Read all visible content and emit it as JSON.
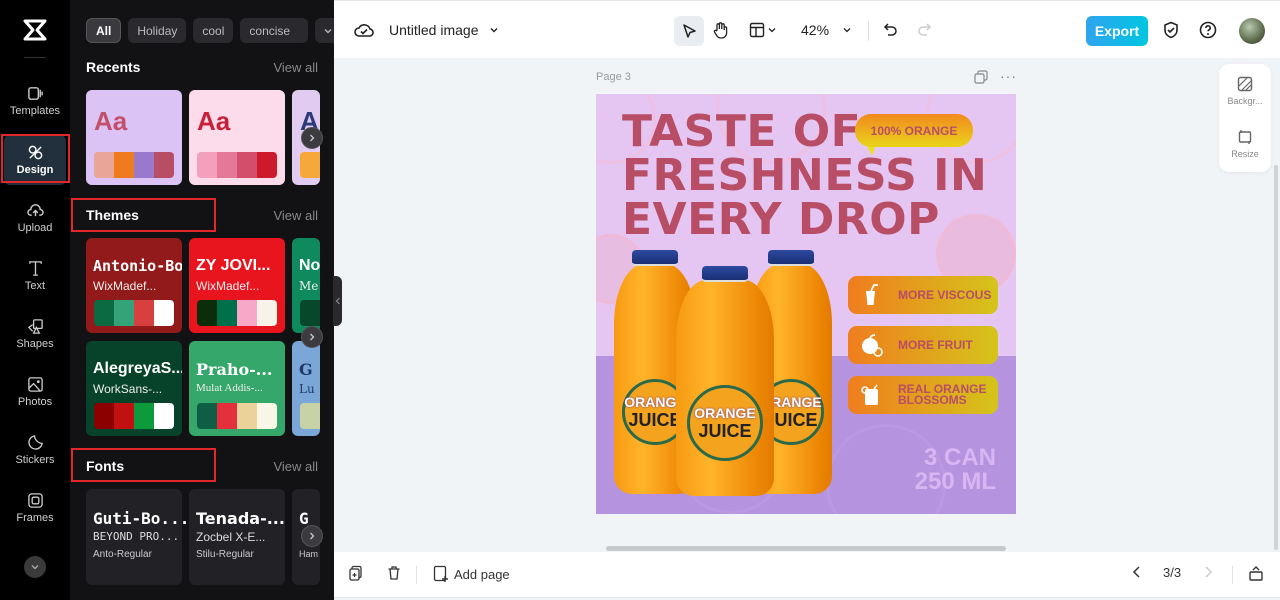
{
  "rail": {
    "items": [
      {
        "label": "Templates",
        "icon": "templates-icon"
      },
      {
        "label": "Design",
        "icon": "design-icon",
        "active": true
      },
      {
        "label": "Upload",
        "icon": "upload-icon"
      },
      {
        "label": "Text",
        "icon": "text-icon"
      },
      {
        "label": "Shapes",
        "icon": "shapes-icon"
      },
      {
        "label": "Photos",
        "icon": "photos-icon"
      },
      {
        "label": "Stickers",
        "icon": "stickers-icon"
      },
      {
        "label": "Frames",
        "icon": "frames-icon"
      }
    ]
  },
  "panel": {
    "chips": [
      "All",
      "Holiday",
      "cool",
      "concise"
    ],
    "recents": {
      "title": "Recents",
      "view_all": "View all",
      "cards": [
        {
          "sample": "Aa",
          "bg": "#dcc3f5",
          "text_color": "#c2506a",
          "palette": [
            "#e8a598",
            "#f07a1e",
            "#9a78cc",
            "#b84d66"
          ]
        },
        {
          "sample": "Aa",
          "bg": "#fcdcea",
          "text_color": "#c8203a",
          "palette": [
            "#f2a0bc",
            "#e47898",
            "#d24e6a",
            "#cc1a2a"
          ]
        },
        {
          "sample": "A",
          "bg": "#e2cbf0",
          "text_color": "#2b3a78",
          "palette": [
            "#f6a83a"
          ]
        }
      ]
    },
    "themes": {
      "title": "Themes",
      "view_all": "View all",
      "cards": [
        {
          "font1": "Antonio-Bold",
          "font2": "WixMadef...",
          "bg": "#931a1a",
          "palette": [
            "#0c6a42",
            "#35a37a",
            "#d84040",
            "#ffffff"
          ]
        },
        {
          "font1": "ZY JOVI...",
          "font2": "WixMadef...",
          "bg": "#e8141e",
          "palette": [
            "#0a2e0a",
            "#00704a",
            "#f7a8c8",
            "#f8f3e8"
          ]
        },
        {
          "font1": "No",
          "font2": "Me",
          "bg": "#0e8a5e",
          "palette": [
            "#07472a"
          ]
        },
        {
          "font1": "AlegreyaS...",
          "font2": "WorkSans-...",
          "bg": "#07432a",
          "palette": [
            "#8c0000",
            "#c01010",
            "#0c9a3c",
            "#ffffff"
          ]
        },
        {
          "font1": "Praho-...",
          "font2": "Mulat Addis-...",
          "bg": "#36a76a",
          "palette": [
            "#0d5e44",
            "#e3303c",
            "#ead29a",
            "#f9f6e8"
          ]
        },
        {
          "font1": "G",
          "font2": "Lu",
          "bg": "#7aa6d8",
          "palette": [
            "#c7d2a6"
          ]
        }
      ]
    },
    "fonts": {
      "title": "Fonts",
      "view_all": "View all",
      "cards": [
        {
          "line1": "Guti-Bo...",
          "line2": "BEYOND PRO...",
          "line3": "Anto-Regular"
        },
        {
          "line1": "Tenada-...",
          "line2": "Zocbel X-E...",
          "line3": "Stilu-Regular"
        },
        {
          "line1": "G",
          "line2": "",
          "line3": "Ham"
        }
      ]
    }
  },
  "topbar": {
    "doc_title": "Untitled image",
    "zoom": "42%",
    "export_label": "Export"
  },
  "side_tools": [
    {
      "label": "Backgr...",
      "icon": "background-icon"
    },
    {
      "label": "Resize",
      "icon": "resize-icon"
    }
  ],
  "canvas": {
    "page_label": "Page 3",
    "headline": [
      "TASTE OF",
      "FRESHNESS IN",
      "EVERY DROP"
    ],
    "badge": "100% ORANGE",
    "features": [
      {
        "label": "MORE VISCOUS",
        "icon": "drink-straw-icon"
      },
      {
        "label": "MORE FRUIT",
        "icon": "orange-fruit-icon"
      },
      {
        "label": "REAL ORANGE BLOSSOMS",
        "icon": "juice-glass-icon"
      }
    ],
    "quantity": [
      "3 CAN",
      "250 ML"
    ],
    "bottle_label": {
      "top": "ORANGE",
      "bottom": "JUICE"
    },
    "colors": {
      "headline": "#b84d66",
      "bg_top": "#e5c6f2",
      "bg_bottom": "#b593de"
    }
  },
  "bottombar": {
    "add_page": "Add page",
    "page_indicator": "3/3"
  }
}
